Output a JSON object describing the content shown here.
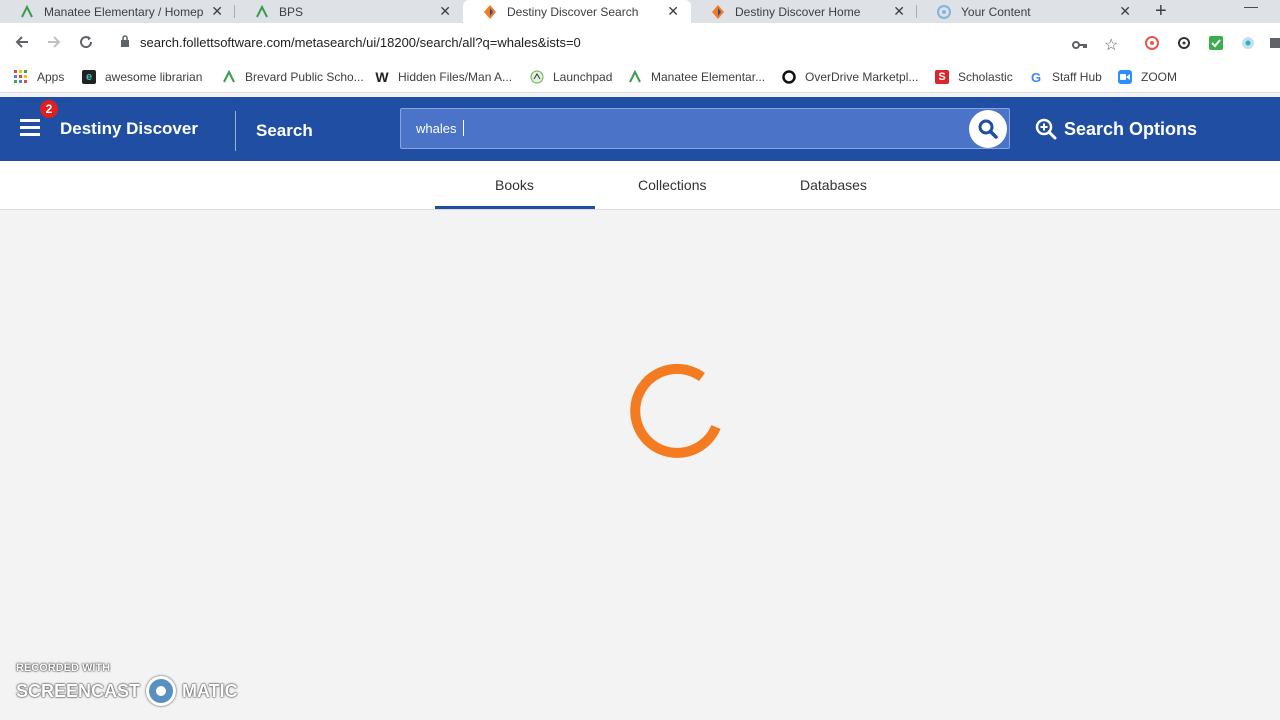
{
  "browser": {
    "tabs": [
      {
        "title": "Manatee Elementary / Homepage",
        "icon": "green-fan-icon"
      },
      {
        "title": "BPS",
        "icon": "green-fan-icon"
      },
      {
        "title": "Destiny Discover Search",
        "icon": "destiny-icon",
        "active": true
      },
      {
        "title": "Destiny Discover Home",
        "icon": "destiny-icon"
      },
      {
        "title": "Your Content",
        "icon": "circle-icon"
      }
    ],
    "url": "search.follettsoftware.com/metasearch/ui/18200/search/all?q=whales&ists=0",
    "bookmarks": [
      {
        "label": "Apps",
        "icon": "apps-grid-icon"
      },
      {
        "label": "awesome librarian",
        "icon": "awesome-icon"
      },
      {
        "label": "Brevard Public Scho...",
        "icon": "green-fan-icon"
      },
      {
        "label": "Hidden Files/Man A...",
        "icon": "w-icon"
      },
      {
        "label": "Launchpad",
        "icon": "launchpad-icon"
      },
      {
        "label": "Manatee Elementar...",
        "icon": "green-fan-icon"
      },
      {
        "label": "OverDrive Marketpl...",
        "icon": "overdrive-icon"
      },
      {
        "label": "Scholastic",
        "icon": "scholastic-icon"
      },
      {
        "label": "Staff Hub",
        "icon": "google-icon"
      },
      {
        "label": "ZOOM",
        "icon": "zoom-icon"
      }
    ]
  },
  "header": {
    "badge_count": "2",
    "brand": "Destiny Discover",
    "section": "Search",
    "search_value": "whales",
    "search_options": "Search Options"
  },
  "content_tabs": [
    {
      "label": "Books",
      "active": true
    },
    {
      "label": "Collections"
    },
    {
      "label": "Databases"
    }
  ],
  "watermark": {
    "recorded_with": "RECORDED WITH",
    "left": "SCREENCAST",
    "right": "MATIC"
  },
  "colors": {
    "header_bg": "#1f4ea3",
    "spinner": "#f47b20",
    "badge": "#e02020"
  }
}
